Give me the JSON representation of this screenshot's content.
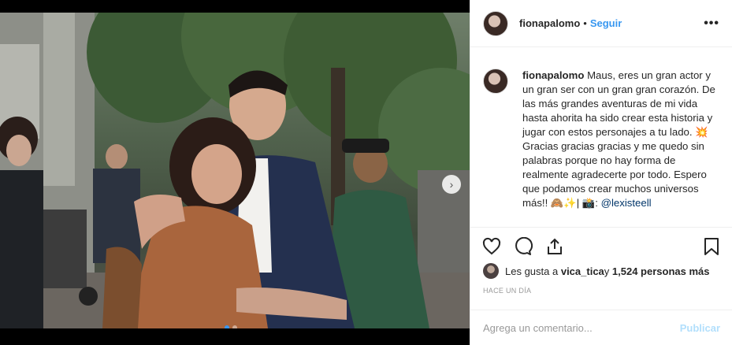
{
  "post": {
    "author": {
      "username": "fionapalomo",
      "separator": "•",
      "follow_label": "Seguir",
      "more_label": "•••"
    },
    "caption": {
      "username": "fionapalomo",
      "text": " Maus, eres un gran actor y un gran ser con un gran gran corazón. De las más grandes aventuras de mi vida hasta ahorita ha sido crear esta historia y jugar con estos personajes a tu lado. 💥 Gracias gracias gracias y me quedo sin palabras porque no hay forma de realmente agradecerte por todo. Espero que podamos crear muchos universos más!! 🙈✨| 📸: ",
      "mention": "@lexisteell"
    },
    "media": {
      "slide_count": 2,
      "active_slide": 1
    },
    "likes": {
      "prefix": "Les gusta a ",
      "first_user": "vica_tica",
      "connector": " y ",
      "count_text": "1,524 personas más"
    },
    "timestamp": "Hace un día",
    "comment": {
      "placeholder": "Agrega un comentario...",
      "publish_label": "Publicar"
    },
    "icons": [
      "heart-icon",
      "comment-icon",
      "share-icon",
      "bookmark-icon",
      "chevron-right-icon"
    ],
    "colors": {
      "link": "#3897f0",
      "publish_disabled": "#b2dffc",
      "text": "#262626",
      "muted": "#999999"
    }
  }
}
